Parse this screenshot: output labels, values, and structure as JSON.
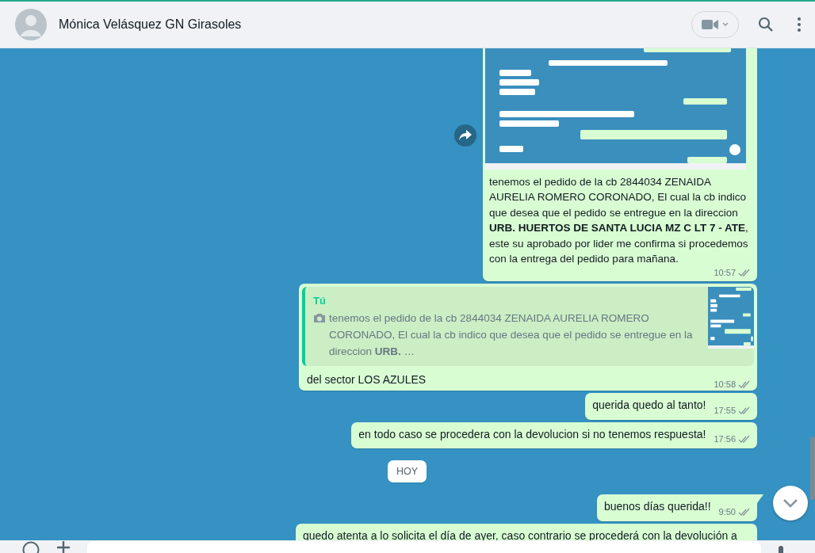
{
  "header": {
    "contact_name": "Mónica Velásquez GN Girasoles"
  },
  "messages": [
    {
      "tail": false,
      "forward": true,
      "text": "tenemos el pedido de la cb 2844034 ZENAIDA AURELIA ROMERO CORONADO, El cual la cb indico que desea que el pedido se entregue en la direccion **URB. HUERTOS DE SANTA LUCIA MZ C LT 7 - ATE**, este su aprobado por lider me confirma si procedemos con la entrega del pedido para mañana.",
      "time": "10:57",
      "read": false
    },
    {
      "kind": "reply",
      "tail": false,
      "forward": false,
      "quote": {
        "author": "Tú",
        "text": "tenemos el pedido de la cb 2844034 ZENAIDA AURELIA ROMERO CORONADO, El cual la cb indico que desea que el pedido se entregue en la direccion **URB.** …"
      },
      "text": "del sector LOS AZULES",
      "time": "10:58",
      "read": false
    },
    {
      "kind": "text",
      "tail": false,
      "forward": false,
      "text": "querida quedo al tanto!",
      "time": "17:55",
      "read": false
    },
    {
      "kind": "text",
      "tail": false,
      "forward": false,
      "text": "en todo caso se procedera con la devolucion si no tenemos respuesta!",
      "time": "17:56",
      "read": false
    },
    {
      "kind": "date",
      "text": "HOY"
    },
    {
      "kind": "text",
      "tail": true,
      "forward": false,
      "text": "buenos días querida!!",
      "time": "9:50",
      "read": false
    },
    {
      "kind": "text",
      "tail": false,
      "forward": false,
      "text": "quedo atenta a lo solicita el día de ayer, caso contrario se procederá con la devolución a"
    }
  ]
}
